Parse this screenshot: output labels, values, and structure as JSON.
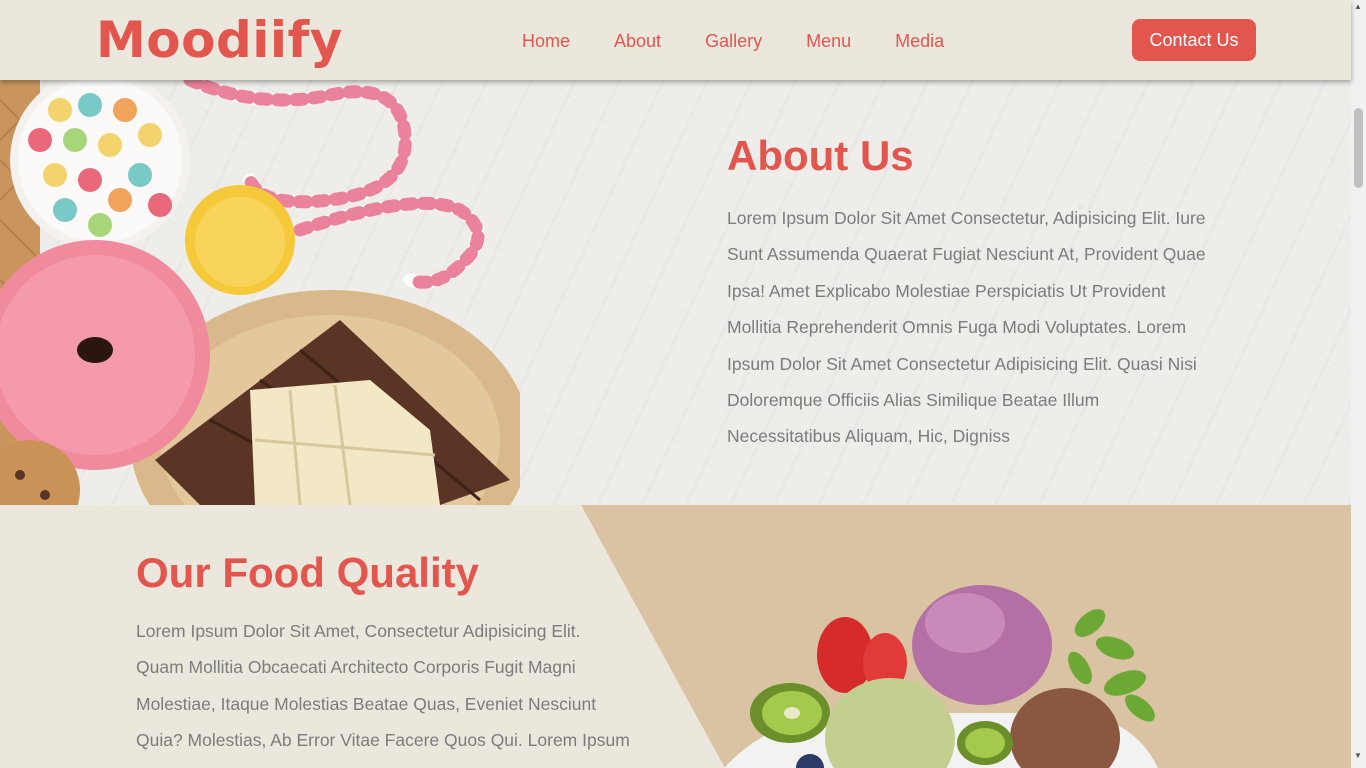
{
  "brand": {
    "name": "Moodiify",
    "accent": "#e2564e",
    "header_bg": "#ebe7dc",
    "quality_right_bg": "#d9c3a2"
  },
  "nav": {
    "items": [
      {
        "label": "Home"
      },
      {
        "label": "About"
      },
      {
        "label": "Gallery"
      },
      {
        "label": "Menu"
      },
      {
        "label": "Media"
      }
    ]
  },
  "header": {
    "contact_label": "Contact Us"
  },
  "about": {
    "title": "About Us",
    "text": "Lorem Ipsum Dolor Sit Amet Consectetur, Adipisicing Elit. Iure Sunt Assumenda Quaerat Fugiat Nesciunt At, Provident Quae Ipsa! Amet Explicabo Molestiae Perspiciatis Ut Provident Mollitia Reprehenderit Omnis Fuga Modi Voluptates. Lorem Ipsum Dolor Sit Amet Consectetur Adipisicing Elit. Quasi Nisi Doloremque Officiis Alias Similique Beatae Illum Necessitatibus Aliquam, Hic, Digniss",
    "image_icon": "sweets-image"
  },
  "quality": {
    "title": "Our Food Quality",
    "text": "Lorem Ipsum Dolor Sit Amet, Consectetur Adipisicing Elit. Quam Mollitia Obcaecati Architecto Corporis Fugit Magni Molestiae, Itaque Molestias Beatae Quas, Eveniet Nesciunt Quia? Molestias, Ab Error Vitae Facere Quos Qui. Lorem Ipsum",
    "image_icon": "ice-cream-image"
  }
}
